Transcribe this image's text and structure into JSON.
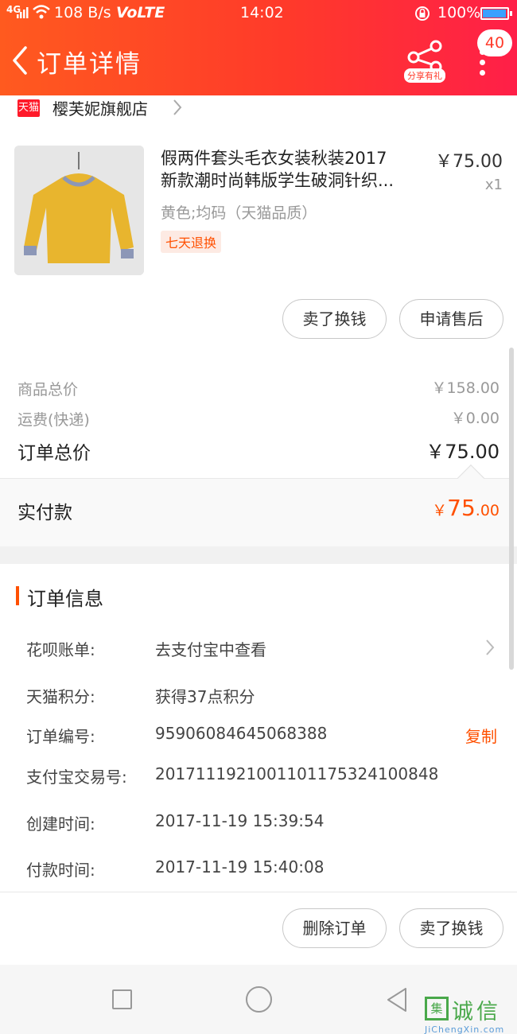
{
  "status_bar": {
    "network": "4G",
    "speed": "108 B/s",
    "volte": "VoLTE",
    "time": "14:02",
    "battery": "100%"
  },
  "header": {
    "title": "订单详情",
    "share_tag": "分享有礼",
    "badge_count": "40"
  },
  "shop": {
    "logo_text": "天猫",
    "name": "樱芙妮旗舰店"
  },
  "product": {
    "title_line1": "假两件套头毛衣女装秋装2017",
    "title_line2": "新款潮时尚韩版学生破洞针织...",
    "price": "￥75.00",
    "qty": "x1",
    "spec": "黄色;均码（天猫品质）",
    "tag": "七天退换",
    "image_colors": {
      "sweater": "#e8b52e",
      "background": "#e4e4e4"
    }
  },
  "product_actions": {
    "sell": "卖了换钱",
    "after_sale": "申请售后"
  },
  "price_summary": {
    "goods_total_label": "商品总价",
    "goods_total_value": "￥158.00",
    "shipping_label": "运费(快递)",
    "shipping_value": "￥0.00",
    "order_total_label": "订单总价",
    "order_total_value": "￥75.00",
    "paid_label": "实付款",
    "paid_symbol": "￥",
    "paid_int": "75",
    "paid_dec": ".00"
  },
  "order_info": {
    "section_title": "订单信息",
    "copy_label": "复制",
    "rows": [
      {
        "label": "花呗账单:",
        "value": "去支付宝中查看"
      },
      {
        "label": "天猫积分:",
        "value": "获得37点积分"
      },
      {
        "label": "订单编号:",
        "value": "95906084645068388"
      },
      {
        "label": "支付宝交易号:",
        "value": "2017111921001101175324100848"
      },
      {
        "label": "创建时间:",
        "value": "2017-11-19 15:39:54"
      },
      {
        "label": "付款时间:",
        "value": "2017-11-19 15:40:08"
      }
    ]
  },
  "bottom_actions": {
    "delete": "删除订单",
    "sell": "卖了换钱"
  },
  "watermark": {
    "icon_text": "集",
    "main": "诚信",
    "sub": "JiChengXin.com"
  },
  "colors": {
    "accent": "#ff5000",
    "header_start": "#ff5a1f",
    "header_end": "#ff1f48"
  }
}
